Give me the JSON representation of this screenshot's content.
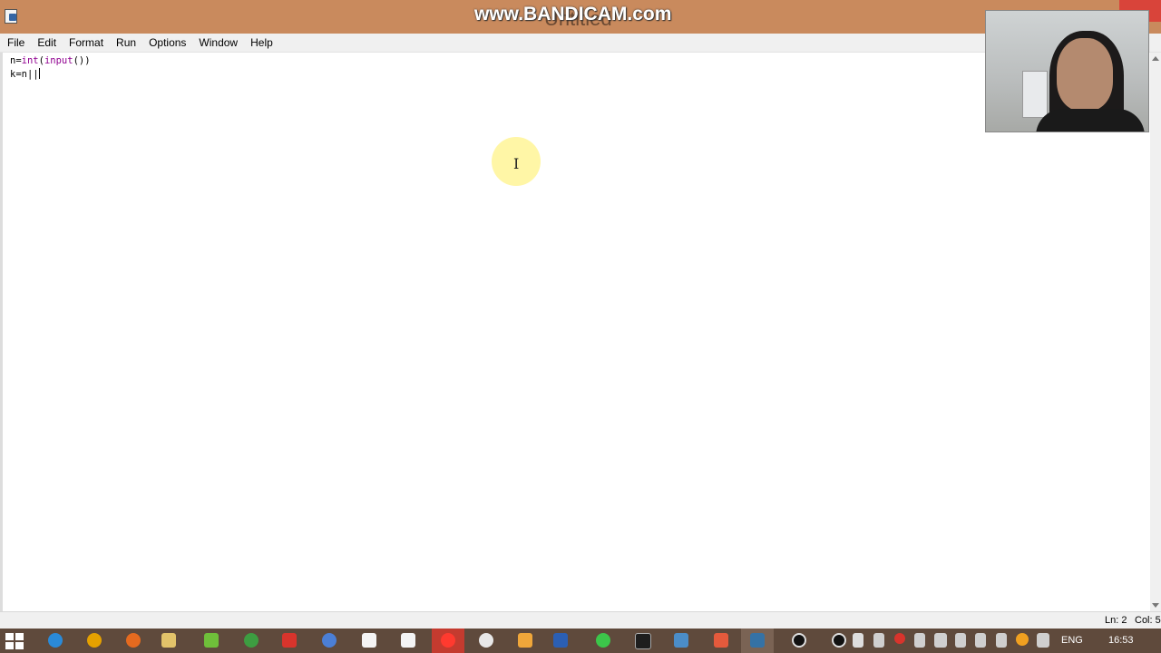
{
  "window": {
    "title": "Untitled",
    "watermark": "www.BANDICAM.com"
  },
  "menu": {
    "items": [
      "File",
      "Edit",
      "Format",
      "Run",
      "Options",
      "Window",
      "Help"
    ]
  },
  "editor": {
    "line1_var": "n=",
    "line1_int": "int",
    "line1_paren_open": "(",
    "line1_input": "input",
    "line1_rest": "())",
    "line2_text": "k=n||"
  },
  "status": {
    "line": "Ln: 2",
    "col": "Col: 5"
  },
  "taskbar": {
    "language": "ENG",
    "time": "16:53",
    "icons": [
      "ie-icon",
      "avast-icon",
      "firefox-icon",
      "explorer-icon",
      "android-icon",
      "chrome-icon",
      "yandex-icon",
      "paint-icon",
      "file-icon",
      "file-icon",
      "opera-icon",
      "yandex-browser-icon",
      "pen-icon",
      "word-icon",
      "whatsapp-icon",
      "terminal-icon",
      "window-icon",
      "app-icon",
      "python-icon",
      "bandicam-icon"
    ]
  },
  "colors": {
    "titlebar": "#c98a5d",
    "taskbar": "#5f4a3c",
    "builtin": "#900090"
  }
}
